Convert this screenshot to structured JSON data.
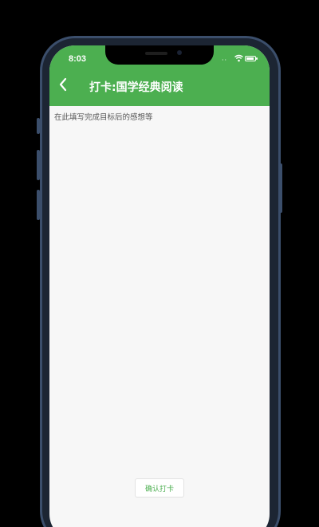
{
  "status_bar": {
    "time": "8:03",
    "icons": [
      "signal-icon",
      "wifi-icon",
      "battery-icon"
    ]
  },
  "nav_bar": {
    "back_icon": "chevron-left-icon",
    "title": "打卡:国学经典阅读"
  },
  "feeling_input": {
    "placeholder": "在此填写完成目标后的感想等",
    "value": ""
  },
  "confirm_button": {
    "label": "确认打卡"
  },
  "colors": {
    "accent": "#4caf50",
    "background": "#f7f7f7",
    "frame": "#3b4e6b"
  }
}
